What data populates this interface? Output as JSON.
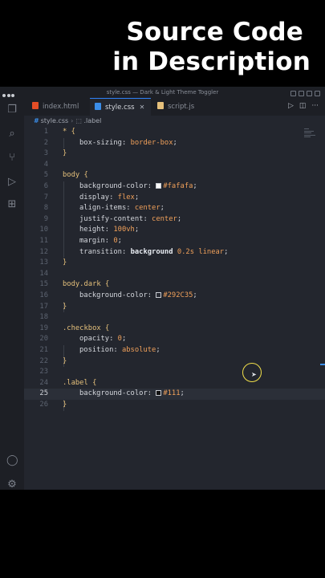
{
  "banner": {
    "line1": "Source Code",
    "line2": "in Description"
  },
  "window": {
    "title": "style.css — Dark & Light Theme Toggler"
  },
  "tabs": [
    {
      "label": "index.html",
      "icon": "html-file-icon",
      "color": "#e44d26"
    },
    {
      "label": "style.css",
      "icon": "css-file-icon",
      "color": "#3b8eea"
    },
    {
      "label": "script.js",
      "icon": "js-file-icon",
      "color": "#e5c07b"
    }
  ],
  "breadcrumb": {
    "file": "style.css",
    "symbol": ".label"
  },
  "colors": {
    "accent": "#2f81f7",
    "background": "#23262e",
    "selector": "#e5c07b",
    "value": "#f0a05a"
  },
  "code": [
    {
      "n": "1",
      "text": "* {"
    },
    {
      "n": "2",
      "text": "box-sizing: border-box;"
    },
    {
      "n": "3",
      "text": "}"
    },
    {
      "n": "4",
      "text": ""
    },
    {
      "n": "5",
      "text": "body {"
    },
    {
      "n": "6",
      "text": "background-color: #fafafa;"
    },
    {
      "n": "7",
      "text": "display: flex;"
    },
    {
      "n": "8",
      "text": "align-items: center;"
    },
    {
      "n": "9",
      "text": "justify-content: center;"
    },
    {
      "n": "10",
      "text": "height: 100vh;"
    },
    {
      "n": "11",
      "text": "margin: 0;"
    },
    {
      "n": "12",
      "text": "transition: background 0.2s linear;"
    },
    {
      "n": "13",
      "text": "}"
    },
    {
      "n": "14",
      "text": ""
    },
    {
      "n": "15",
      "text": "body.dark {"
    },
    {
      "n": "16",
      "text": "background-color: #292C35;"
    },
    {
      "n": "17",
      "text": "}"
    },
    {
      "n": "18",
      "text": ""
    },
    {
      "n": "19",
      "text": ".checkbox {"
    },
    {
      "n": "20",
      "text": "opacity: 0;"
    },
    {
      "n": "21",
      "text": "position: absolute;"
    },
    {
      "n": "22",
      "text": "}"
    },
    {
      "n": "23",
      "text": ""
    },
    {
      "n": "24",
      "text": ".label {"
    },
    {
      "n": "25",
      "text": "background-color: #111;"
    },
    {
      "n": "26",
      "text": "}"
    }
  ]
}
